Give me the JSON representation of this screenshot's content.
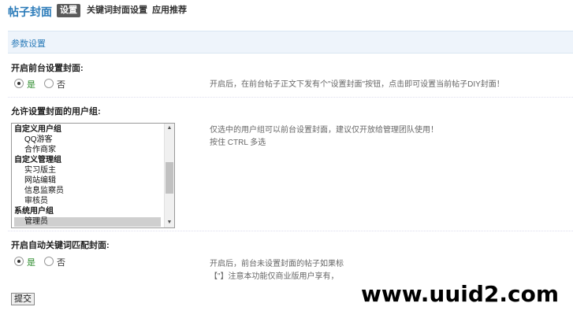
{
  "header": {
    "title": "帖子封面",
    "tabs": [
      {
        "label": "设置",
        "active": true
      },
      {
        "label": "关键词封面设置",
        "active": false
      },
      {
        "label": "应用推荐",
        "active": false
      }
    ]
  },
  "section": {
    "title": "参数设置"
  },
  "frontend_cover": {
    "label": "开启前台设置封面:",
    "yes": "是",
    "no": "否",
    "selected": "yes",
    "tip": "开启后，在前台帖子正文下发有个\"设置封面\"按钮，点击即可设置当前帖子DIY封面！"
  },
  "user_groups": {
    "label": "允许设置封面的用户组:",
    "options": [
      {
        "label": "自定义用户组",
        "group": true,
        "selected": false
      },
      {
        "label": "QQ游客",
        "group": false,
        "selected": false
      },
      {
        "label": "合作商家",
        "group": false,
        "selected": false
      },
      {
        "label": "自定义管理组",
        "group": true,
        "selected": false
      },
      {
        "label": "实习版主",
        "group": false,
        "selected": false
      },
      {
        "label": "网站编辑",
        "group": false,
        "selected": false
      },
      {
        "label": "信息监察员",
        "group": false,
        "selected": false
      },
      {
        "label": "审核员",
        "group": false,
        "selected": false
      },
      {
        "label": "系统用户组",
        "group": true,
        "selected": false
      },
      {
        "label": "管理员",
        "group": false,
        "selected": true
      }
    ],
    "tip_line1": "仅选中的用户组可以前台设置封面，建议仅开放给管理团队使用！",
    "tip_line2": "按住 CTRL 多选"
  },
  "auto_keyword": {
    "label": "开启自动关键词匹配封面:",
    "yes": "是",
    "no": "否",
    "selected": "yes",
    "tip_line1": "开启后，前台未设置封面的帖子如果标",
    "tip_line2": "【\"】注意本功能仅商业版用户享有，"
  },
  "submit_label": "提交",
  "watermark": "www.uuid2.com",
  "colors": {
    "accent": "#2b7bb9",
    "section_bg": "#eef4fb"
  }
}
